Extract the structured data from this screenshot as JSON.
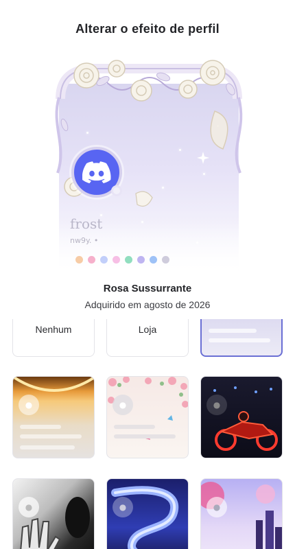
{
  "page": {
    "title": "Alterar o efeito de perfil"
  },
  "preview": {
    "username": "frost",
    "handle": "nw9y. •",
    "effect_name": "Rosa Sussurrante",
    "acquired": "Adquirido em agosto de 2026"
  },
  "options": {
    "none_label": "Nenhum",
    "shop_label": "Loja"
  },
  "effects": [
    {
      "name": "rosa-sussurrante",
      "selected": true
    },
    {
      "name": "golden-glow"
    },
    {
      "name": "floral-butterflies"
    },
    {
      "name": "neon-motorcycle"
    },
    {
      "name": "dark-hands"
    },
    {
      "name": "blue-serpent"
    },
    {
      "name": "purple-city"
    }
  ],
  "colors": {
    "accent": "#5865f2",
    "selected_border": "#6a6fd4"
  }
}
